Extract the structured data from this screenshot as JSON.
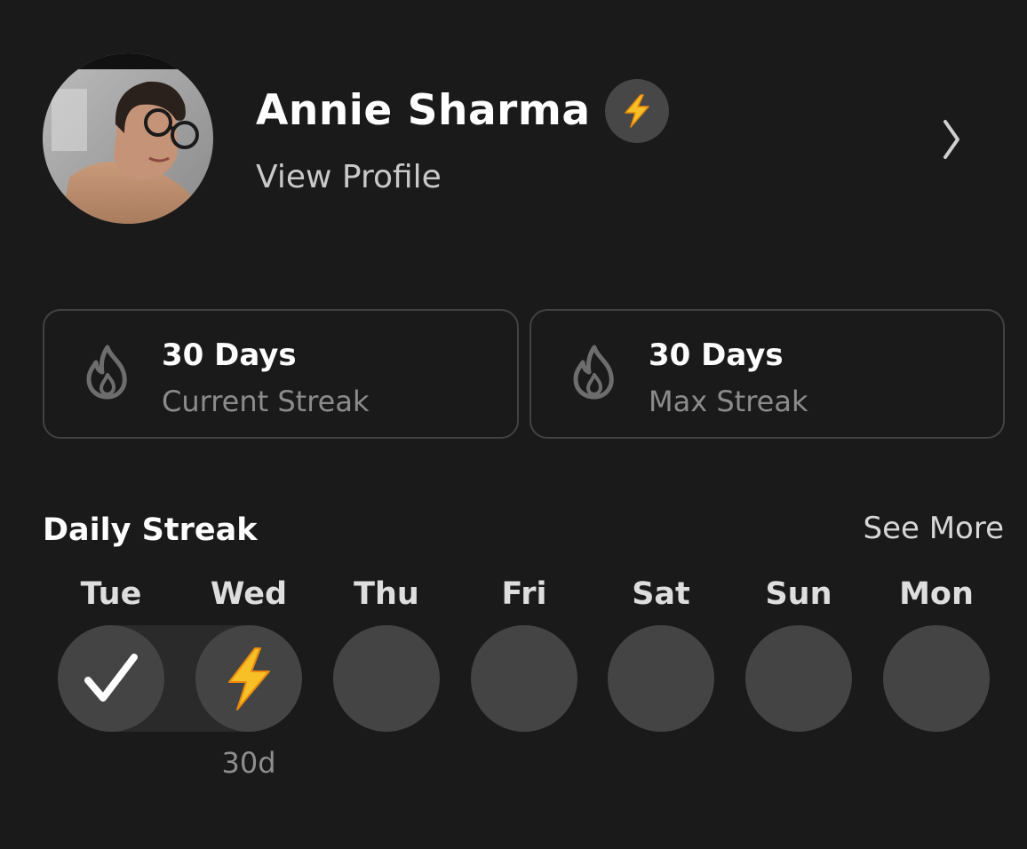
{
  "profile": {
    "name": "Annie Sharma",
    "link_label": "View Profile",
    "avatar": "user-photo-avatar",
    "badge_icon": "lightning-icon",
    "chevron_icon": "chevron-right-icon"
  },
  "stats": [
    {
      "value": "30 Days",
      "label": "Current Streak",
      "icon": "flame-icon"
    },
    {
      "value": "30 Days",
      "label": "Max Streak",
      "icon": "flame-icon"
    }
  ],
  "daily_streak": {
    "title": "Daily Streak",
    "see_more": "See More",
    "days": [
      {
        "label": "Tue",
        "state": "completed",
        "icon": "checkmark-icon"
      },
      {
        "label": "Wed",
        "state": "today",
        "icon": "lightning-icon",
        "count": "30d"
      },
      {
        "label": "Thu",
        "state": "empty"
      },
      {
        "label": "Fri",
        "state": "empty"
      },
      {
        "label": "Sat",
        "state": "empty"
      },
      {
        "label": "Sun",
        "state": "empty"
      },
      {
        "label": "Mon",
        "state": "empty"
      }
    ]
  },
  "colors": {
    "background": "#1a1a1a",
    "circle": "#444444",
    "card_border": "#424242",
    "lightning_yellow": "#f6c026",
    "lightning_orange": "#e8890c"
  }
}
